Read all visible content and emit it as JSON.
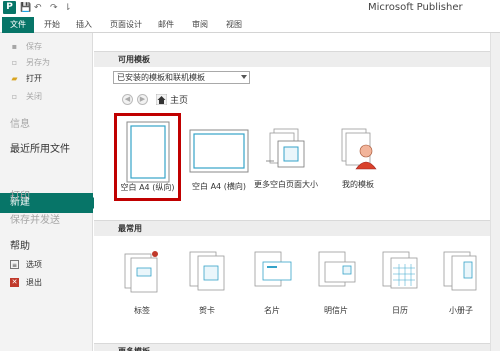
{
  "window": {
    "title": "Microsoft Publisher",
    "app_logo": "P"
  },
  "quick_access": {
    "save": "💾",
    "undo": "↶",
    "redo": "↷",
    "customize": "⇂"
  },
  "ribbon_tabs": [
    {
      "label": "文件",
      "active": true
    },
    {
      "label": "开始"
    },
    {
      "label": "插入"
    },
    {
      "label": "页面设计"
    },
    {
      "label": "邮件"
    },
    {
      "label": "审阅"
    },
    {
      "label": "视图"
    }
  ],
  "backstage": {
    "save": "保存",
    "save_as": "另存为",
    "open": "打开",
    "close": "关闭",
    "info": "信息",
    "recent": "最近所用文件",
    "new": "新建",
    "print": "打印",
    "save_send": "保存并发送",
    "help": "帮助",
    "options": "选项",
    "exit": "退出"
  },
  "main": {
    "available_header": "可用模板",
    "template_source": "已安装的模板和联机模板",
    "home_label": "主页",
    "tiles": [
      {
        "label": "空白 A4 (纵向)"
      },
      {
        "label": "空白 A4 (横向)"
      },
      {
        "label": "更多空白页面大小"
      },
      {
        "label": "我的模板"
      }
    ],
    "common_header": "最常用",
    "common_tiles": [
      {
        "label": "标签"
      },
      {
        "label": "贺卡"
      },
      {
        "label": "名片"
      },
      {
        "label": "明信片"
      },
      {
        "label": "日历"
      },
      {
        "label": "小册子"
      }
    ],
    "more_header": "更多模板"
  },
  "colors": {
    "accent": "#077568",
    "highlight": "#c00000"
  }
}
